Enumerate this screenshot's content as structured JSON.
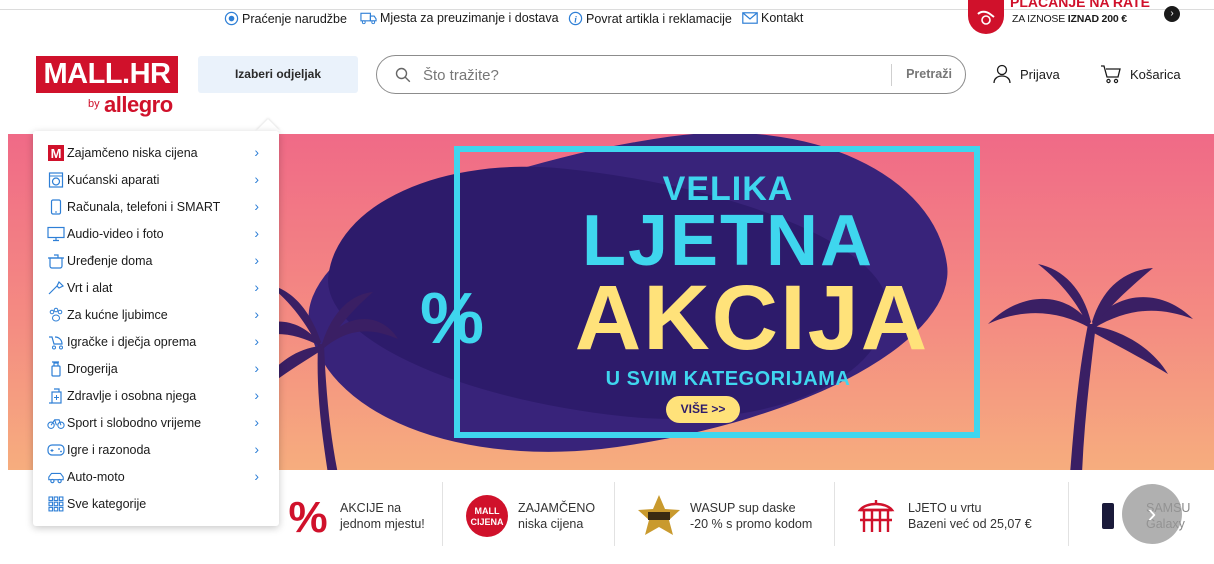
{
  "top_links": {
    "tracking": "Praćenje narudžbe",
    "pickup": "Mjesta za preuzimanje i dostava",
    "returns": "Povrat artikla i reklamacije",
    "contact": "Kontakt"
  },
  "installment": {
    "title": "PLAĆANJE NA RATE",
    "sub_prefix": "ZA IZNOSE",
    "sub_bold": "IZNAD 200 €"
  },
  "logo": {
    "name": "MALL.HR",
    "by": "by",
    "allegro": "allegro"
  },
  "header": {
    "department_button": "Izaberi odjeljak",
    "search_placeholder": "Što tražite?",
    "search_button": "Pretraži",
    "login": "Prijava",
    "cart": "Košarica"
  },
  "banner": {
    "line1": "VELIKA",
    "line2": "LJETNA",
    "line3": "AKCIJA",
    "percent": "%",
    "line4": "U SVIM KATEGORIJAMA",
    "button": "VIŠE >>"
  },
  "menu": {
    "items": [
      {
        "label": "Zajamčeno niska cijena",
        "icon": "mall-m-icon"
      },
      {
        "label": "Kućanski aparati",
        "icon": "washing-machine-icon"
      },
      {
        "label": "Računala, telefoni i SMART",
        "icon": "phone-icon"
      },
      {
        "label": "Audio-video i foto",
        "icon": "monitor-icon"
      },
      {
        "label": "Uređenje doma",
        "icon": "pot-icon"
      },
      {
        "label": "Vrt i alat",
        "icon": "tools-icon"
      },
      {
        "label": "Za kućne ljubimce",
        "icon": "paw-icon"
      },
      {
        "label": "Igračke i dječja oprema",
        "icon": "stroller-icon"
      },
      {
        "label": "Drogerija",
        "icon": "bottle-icon"
      },
      {
        "label": "Zdravlje i osobna njega",
        "icon": "health-icon"
      },
      {
        "label": "Sport i slobodno vrijeme",
        "icon": "bicycle-icon"
      },
      {
        "label": "Igre i razonoda",
        "icon": "gamepad-icon"
      },
      {
        "label": "Auto-moto",
        "icon": "car-icon"
      }
    ],
    "all": "Sve kategorije"
  },
  "promos": [
    {
      "line1": "AKCIJE na",
      "line2": "jednom mjestu!",
      "icon": "percent-icon"
    },
    {
      "line1": "ZAJAMČENO",
      "line2": "niska cijena",
      "icon": "mall-cijena-icon",
      "badge_top": "MALL",
      "badge_bottom": "CIJENA"
    },
    {
      "line1": "WASUP sup daske",
      "line2": "-20 % s promo kodom",
      "icon": "star-badge-icon"
    },
    {
      "line1": "LJETO u vrtu",
      "line2": "Bazeni već od 25,07 €",
      "icon": "gazebo-icon"
    },
    {
      "line1": "SAMSU",
      "line2": "Galaxy",
      "icon": "smartphone-icon"
    }
  ],
  "colors": {
    "brand_red": "#d0112b",
    "link_blue": "#2e7fd6",
    "banner_cyan": "#3fd6ee",
    "banner_yellow": "#ffe27a",
    "banner_purple": "#38237a"
  }
}
